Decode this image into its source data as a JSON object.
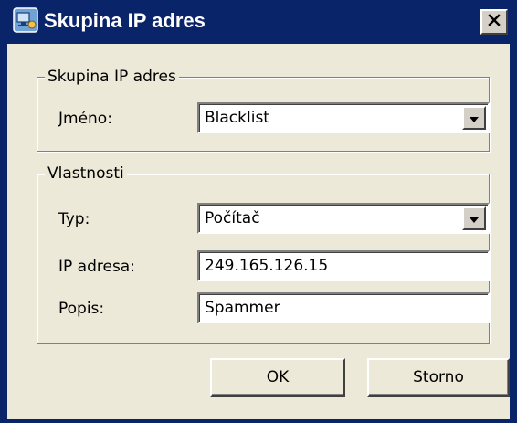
{
  "window": {
    "title": "Skupina IP adres",
    "close_glyph": "✕"
  },
  "group_address": {
    "title": "Skupina IP adres",
    "name_label": "Jméno:",
    "name_value": "Blacklist"
  },
  "group_properties": {
    "title": "Vlastnosti",
    "type_label": "Typ:",
    "type_value": "Počítač",
    "ip_label": "IP adresa:",
    "ip_value": "249.165.126.15",
    "desc_label": "Popis:",
    "desc_value": "Spammer"
  },
  "buttons": {
    "ok_label": "OK",
    "cancel_label": "Storno"
  },
  "colors": {
    "titlebar": "#0a246a",
    "dialog_bg": "#ece9d8"
  },
  "icons": {
    "app": "network-computer-icon",
    "close": "close-icon",
    "dropdown": "chevron-down-icon"
  }
}
